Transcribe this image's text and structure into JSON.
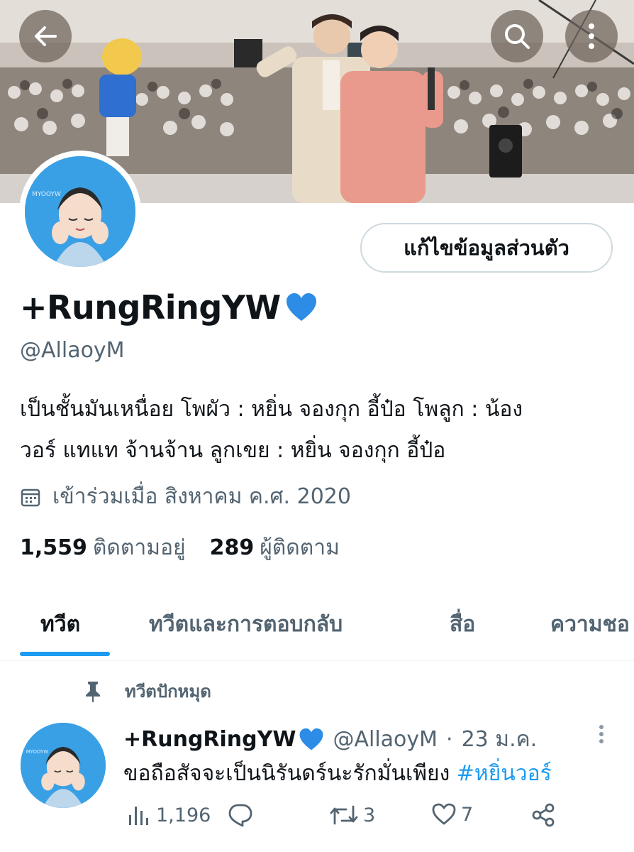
{
  "header": {
    "back_icon": "arrow-left-icon",
    "search_icon": "search-icon",
    "more_icon": "more-vertical-icon"
  },
  "profile": {
    "edit_button_label": "แก้ไขข้อมูลส่วนตัว",
    "display_name": "+RungRingYW",
    "name_emoji": "blue-heart-icon",
    "handle": "@AllaoyM",
    "bio_line1": "เป็นชั้นมันเหนื่อย โพผัว : หยิ่น จองกุก อี้ป๋อ โพลูก : น้อง",
    "bio_line2": "วอร์ แทแท จ้านจ้าน ลูกเขย : หยิ่น จองกุก อี้ป๋อ",
    "joined": "เข้าร่วมเมื่อ สิงหาคม ค.ศ. 2020",
    "following_count": "1,559",
    "following_label": "ติดตามอยู่",
    "followers_count": "289",
    "followers_label": "ผู้ติดตาม",
    "avatar_caption": "MYOOYW"
  },
  "tabs": [
    {
      "label": "ทวีต",
      "active": true
    },
    {
      "label": "ทวีตและการตอบกลับ",
      "active": false
    },
    {
      "label": "สื่อ",
      "active": false
    },
    {
      "label": "ความชอ",
      "active": false
    }
  ],
  "tweet": {
    "pinned_label": "ทวีตปักหมุด",
    "name": "+RungRingYW",
    "handle": "@AllaoyM",
    "separator": "·",
    "date": "23 ม.ค.",
    "text": "ขอถือสัจจะเป็นนิรันดร์นะรักมั่นเพียง ",
    "hashtag": "#หยิ่นวอร์",
    "views": "1,196",
    "replies": "",
    "retweets": "3",
    "likes": "7"
  },
  "colors": {
    "accent": "#1d9bf0",
    "text_primary": "#0f1419",
    "text_secondary": "#536471",
    "border": "#cfd9de"
  }
}
